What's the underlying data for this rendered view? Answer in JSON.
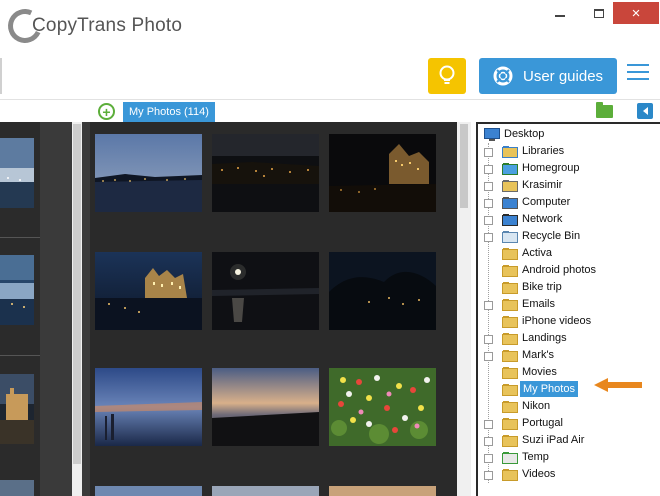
{
  "app": {
    "title": "CopyTrans Photo"
  },
  "window": {
    "minimize": "minimize",
    "maximize": "maximize",
    "close": "×"
  },
  "toolbar": {
    "user_guides_label": "User guides"
  },
  "album": {
    "tab_label": "My Photos (114)"
  },
  "tree": {
    "root": "Desktop",
    "items": [
      {
        "label": "Libraries",
        "icon": "libraries-icon",
        "expandable": true
      },
      {
        "label": "Homegroup",
        "icon": "homegroup-icon",
        "expandable": true
      },
      {
        "label": "Krasimir",
        "icon": "user-folder-icon",
        "expandable": true
      },
      {
        "label": "Computer",
        "icon": "computer-icon",
        "expandable": true
      },
      {
        "label": "Network",
        "icon": "network-icon",
        "expandable": true
      },
      {
        "label": "Recycle Bin",
        "icon": "recycle-bin-icon",
        "expandable": true
      },
      {
        "label": "Activa",
        "icon": "folder-icon",
        "expandable": false
      },
      {
        "label": "Android photos",
        "icon": "folder-icon",
        "expandable": false
      },
      {
        "label": "Bike trip",
        "icon": "folder-icon",
        "expandable": false
      },
      {
        "label": "Emails",
        "icon": "folder-icon",
        "expandable": true
      },
      {
        "label": "iPhone videos",
        "icon": "folder-icon",
        "expandable": false
      },
      {
        "label": "Landings",
        "icon": "folder-icon",
        "expandable": true
      },
      {
        "label": "Mark's",
        "icon": "folder-icon",
        "expandable": true
      },
      {
        "label": "Movies",
        "icon": "folder-icon",
        "expandable": false
      },
      {
        "label": "My Photos",
        "icon": "folder-icon",
        "expandable": false,
        "selected": true
      },
      {
        "label": "Nikon",
        "icon": "folder-icon",
        "expandable": false
      },
      {
        "label": "Portugal",
        "icon": "folder-icon",
        "expandable": true
      },
      {
        "label": "Suzi iPad Air",
        "icon": "folder-icon",
        "expandable": true
      },
      {
        "label": "Temp",
        "icon": "temp-folder-icon",
        "expandable": true
      },
      {
        "label": "Videos",
        "icon": "folder-icon",
        "expandable": true
      }
    ]
  },
  "colors": {
    "accent": "#3a97d8",
    "tip": "#f5c400",
    "add": "#5cae3a",
    "close": "#c9463b",
    "arrow": "#e8871e"
  }
}
